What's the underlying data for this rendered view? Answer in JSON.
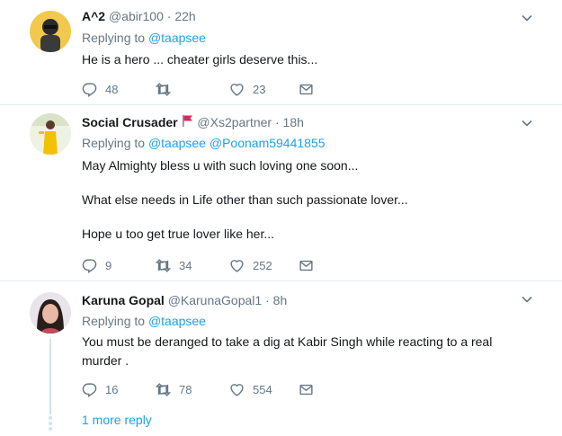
{
  "tweets": [
    {
      "name": "A^2",
      "handle": "@abir100",
      "time": "22h",
      "replying_label": "Replying to",
      "replying_to": [
        "@taapsee"
      ],
      "lines": [
        "He is a hero ... cheater girls deserve this..."
      ],
      "replies": "48",
      "retweets": "",
      "likes": "23"
    },
    {
      "name": "Social Crusader",
      "handle": "@Xs2partner",
      "time": "18h",
      "replying_label": "Replying to",
      "replying_to": [
        "@taapsee",
        "@Poonam59441855"
      ],
      "lines": [
        "May Almighty bless u with such loving one soon...",
        "What else needs in Life other than such passionate lover...",
        "Hope u too get true lover like her..."
      ],
      "replies": "9",
      "retweets": "34",
      "likes": "252"
    },
    {
      "name": "Karuna Gopal",
      "handle": "@KarunaGopal1",
      "time": "8h",
      "replying_label": "Replying to",
      "replying_to": [
        "@taapsee"
      ],
      "lines": [
        "You must be deranged to take a dig at Kabir Singh while reacting to a real murder ."
      ],
      "replies": "16",
      "retweets": "78",
      "likes": "554"
    }
  ],
  "more_replies_label": "1 more reply",
  "icons": {
    "reply": "reply-icon",
    "retweet": "retweet-icon",
    "like": "heart-icon",
    "message": "envelope-icon",
    "menu": "chevron-down-icon",
    "flag": "red-flag-icon"
  },
  "colors": {
    "link": "#1da1f2",
    "muted": "#657786",
    "separator": "#e6ecf0",
    "flag": "#e0245e"
  }
}
